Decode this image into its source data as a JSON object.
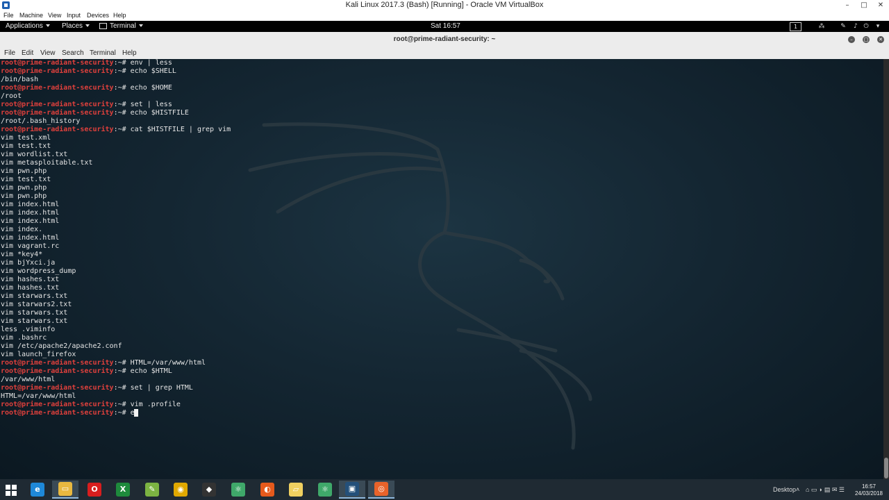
{
  "host_window": {
    "title": "Kali Linux 2017.3 (Bash) [Running] - Oracle VM VirtualBox",
    "minimize": "–",
    "maximize": "□",
    "close": "✕",
    "menu": [
      "File",
      "Machine",
      "View",
      "Input",
      "Devices",
      "Help"
    ]
  },
  "gnome_bar": {
    "applications": "Applications",
    "places": "Places",
    "terminal": "Terminal",
    "clock": "Sat 16:57",
    "workspace": "1"
  },
  "terminal": {
    "title": "root@prime-radiant-security: ~",
    "menu": [
      "File",
      "Edit",
      "View",
      "Search",
      "Terminal",
      "Help"
    ],
    "prompt": "root@prime-radiant-security",
    "lines": [
      {
        "p": true,
        "t": ":~# env | less"
      },
      {
        "p": true,
        "t": ":~# echo $SHELL"
      },
      {
        "p": false,
        "t": "/bin/bash"
      },
      {
        "p": true,
        "t": ":~# echo $HOME"
      },
      {
        "p": false,
        "t": "/root"
      },
      {
        "p": true,
        "t": ":~# set | less"
      },
      {
        "p": true,
        "t": ":~# echo $HISTFILE"
      },
      {
        "p": false,
        "t": "/root/.bash_history"
      },
      {
        "p": true,
        "t": ":~# cat $HISTFILE | grep vim"
      },
      {
        "p": false,
        "t": "vim test.xml"
      },
      {
        "p": false,
        "t": "vim test.txt"
      },
      {
        "p": false,
        "t": "vim wordlist.txt"
      },
      {
        "p": false,
        "t": "vim metasploitable.txt"
      },
      {
        "p": false,
        "t": "vim pwn.php"
      },
      {
        "p": false,
        "t": "vim test.txt"
      },
      {
        "p": false,
        "t": "vim pwn.php"
      },
      {
        "p": false,
        "t": "vim pwn.php"
      },
      {
        "p": false,
        "t": "vim index.html"
      },
      {
        "p": false,
        "t": "vim index.html"
      },
      {
        "p": false,
        "t": "vim index.html"
      },
      {
        "p": false,
        "t": "vim index."
      },
      {
        "p": false,
        "t": "vim index.html"
      },
      {
        "p": false,
        "t": "vim vagrant.rc"
      },
      {
        "p": false,
        "t": "vim *key4*"
      },
      {
        "p": false,
        "t": "vim bjYxci.ja"
      },
      {
        "p": false,
        "t": "vim wordpress_dump"
      },
      {
        "p": false,
        "t": "vim hashes.txt"
      },
      {
        "p": false,
        "t": "vim hashes.txt"
      },
      {
        "p": false,
        "t": "vim starwars.txt"
      },
      {
        "p": false,
        "t": "vim starwars2.txt"
      },
      {
        "p": false,
        "t": "vim starwars.txt"
      },
      {
        "p": false,
        "t": "vim starwars.txt"
      },
      {
        "p": false,
        "t": "less .viminfo"
      },
      {
        "p": false,
        "t": "vim .bashrc"
      },
      {
        "p": false,
        "t": "vim /etc/apache2/apache2.conf"
      },
      {
        "p": false,
        "t": "vim launch_firefox"
      },
      {
        "p": true,
        "t": ":~# HTML=/var/www/html"
      },
      {
        "p": true,
        "t": ":~# echo $HTML"
      },
      {
        "p": false,
        "t": "/var/www/html"
      },
      {
        "p": true,
        "t": ":~# set | grep HTML"
      },
      {
        "p": false,
        "t": "HTML=/var/www/html"
      },
      {
        "p": true,
        "t": ":~# vim .profile"
      },
      {
        "p": true,
        "t": ":~# e"
      }
    ]
  },
  "taskbar": {
    "apps": [
      {
        "name": "ie-icon",
        "glyph": "e",
        "color": "#1e88d8"
      },
      {
        "name": "file-explorer-icon",
        "glyph": "▭",
        "color": "#e8b840",
        "active": true
      },
      {
        "name": "opera-icon",
        "glyph": "O",
        "color": "#d81e1e"
      },
      {
        "name": "excel-icon",
        "glyph": "X",
        "color": "#1e8a3c"
      },
      {
        "name": "notepad-plus-icon",
        "glyph": "✎",
        "color": "#7cb342"
      },
      {
        "name": "chrome-icon",
        "glyph": "◉",
        "color": "#e0a800"
      },
      {
        "name": "git-icon",
        "glyph": "◆",
        "color": "#333333"
      },
      {
        "name": "atom-icon",
        "glyph": "⚛",
        "color": "#3fa86a"
      },
      {
        "name": "firefox-icon",
        "glyph": "◐",
        "color": "#e65a1c"
      },
      {
        "name": "folder-icon",
        "glyph": "▱",
        "color": "#f0d060"
      },
      {
        "name": "atom-icon-2",
        "glyph": "⚛",
        "color": "#3fa86a"
      },
      {
        "name": "virtualbox-icon",
        "glyph": "▣",
        "color": "#24507a",
        "active": true
      },
      {
        "name": "ubuntu-icon",
        "glyph": "◎",
        "color": "#e8632a",
        "active": true
      }
    ],
    "desktop_label": "Desktop",
    "time": "16:57",
    "date": "24/03/2018"
  }
}
